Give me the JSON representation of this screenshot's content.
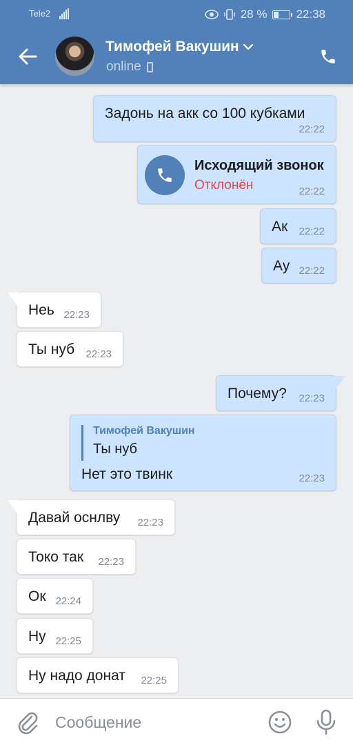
{
  "status_bar": {
    "carrier": "Tele2",
    "network": "4G",
    "battery": "28 %",
    "battery_level": 0.28,
    "time": "22:38"
  },
  "header": {
    "contact_name": "Тимофей Вакушин",
    "status": "online"
  },
  "messages": [
    {
      "dir": "out",
      "text": "Задонь на акк со 100 кубками",
      "time": "22:22"
    },
    {
      "dir": "out",
      "type": "call",
      "title": "Исходящий звонок",
      "status": "Отклонён",
      "time": "22:22"
    },
    {
      "dir": "out",
      "text": "Ак",
      "time": "22:22"
    },
    {
      "dir": "out",
      "text": "Ау",
      "time": "22:22"
    },
    {
      "dir": "in",
      "text": "Неь",
      "time": "22:23"
    },
    {
      "dir": "in",
      "text": "Ты нуб",
      "time": "22:23"
    },
    {
      "dir": "out",
      "text": "Почему?",
      "time": "22:23"
    },
    {
      "dir": "out",
      "type": "reply",
      "reply_author": "Тимофей Вакушин",
      "reply_text": "Ты нуб",
      "text": "Нет это твинк",
      "time": "22:23"
    },
    {
      "dir": "in",
      "text": "Давай оснлву",
      "time": "22:23"
    },
    {
      "dir": "in",
      "text": "Токо так",
      "time": "22:23"
    },
    {
      "dir": "in",
      "text": "Ок",
      "time": "22:24"
    },
    {
      "dir": "in",
      "text": "Ну",
      "time": "22:25"
    },
    {
      "dir": "in",
      "text": "Ну надо донат",
      "time": "22:25"
    }
  ],
  "input": {
    "placeholder": "Сообщение"
  },
  "colors": {
    "header": "#5181b8",
    "outgoing_bubble": "#cce4ff",
    "incoming_bubble": "#ffffff",
    "declined": "#e64646"
  }
}
